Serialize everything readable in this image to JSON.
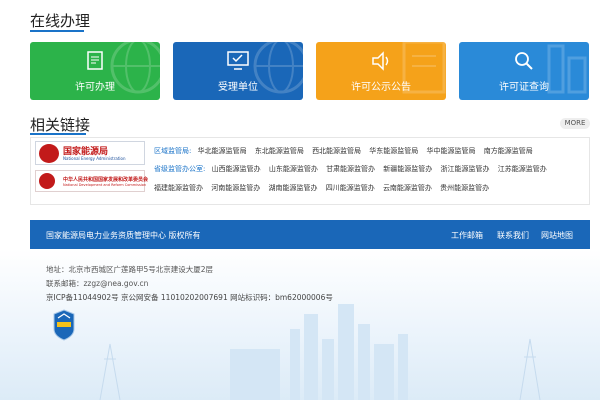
{
  "online": {
    "title": "在线办理"
  },
  "tiles": [
    {
      "label": "许可办理",
      "icon": "certificate-icon",
      "color": "#2cb34a"
    },
    {
      "label": "受理单位",
      "icon": "monitor-check-icon",
      "color": "#1a67b8"
    },
    {
      "label": "许可公示公告",
      "icon": "speaker-icon",
      "color": "#f5a21a"
    },
    {
      "label": "许可证查询",
      "icon": "magnifier-icon",
      "color": "#2a8ad8"
    }
  ],
  "links": {
    "title": "相关链接",
    "more": "MORE",
    "logo1": {
      "title": "国家能源局",
      "sub": "National Energy Administration"
    },
    "logo2": {
      "title": "中华人民共和国国家发展和改革委员会",
      "sub": "National Development and Reform Commission"
    },
    "row1": {
      "label": "区域监管局:",
      "items": [
        "华北能源监管局",
        "东北能源监管局",
        "西北能源监管局",
        "华东能源监管局",
        "华中能源监管局",
        "南方能源监管局"
      ]
    },
    "row2": {
      "label": "省级监管办公室:",
      "items": [
        "山西能源监管办",
        "山东能源监管办",
        "甘肃能源监管办",
        "新疆能源监管办",
        "浙江能源监管办",
        "江苏能源监管办"
      ]
    },
    "row3": {
      "items": [
        "福建能源监管办",
        "河南能源监管办",
        "湖南能源监管办",
        "四川能源监管办",
        "云南能源监管办",
        "贵州能源监管办"
      ]
    }
  },
  "footer": {
    "copyright": "国家能源局电力业务资质管理中心 版权所有",
    "links": [
      "工作邮箱",
      "联系我们",
      "网站地图"
    ],
    "address": "地址：北京市西城区广莲路甲5号北京建设大厦2层",
    "email": "联系邮箱：zzgz@nea.gov.cn",
    "icp": "京ICP备11044902号 京公网安备 11010202007691 网站标识码：bm62000006号",
    "badge_icon": "government-site-badge-icon"
  }
}
